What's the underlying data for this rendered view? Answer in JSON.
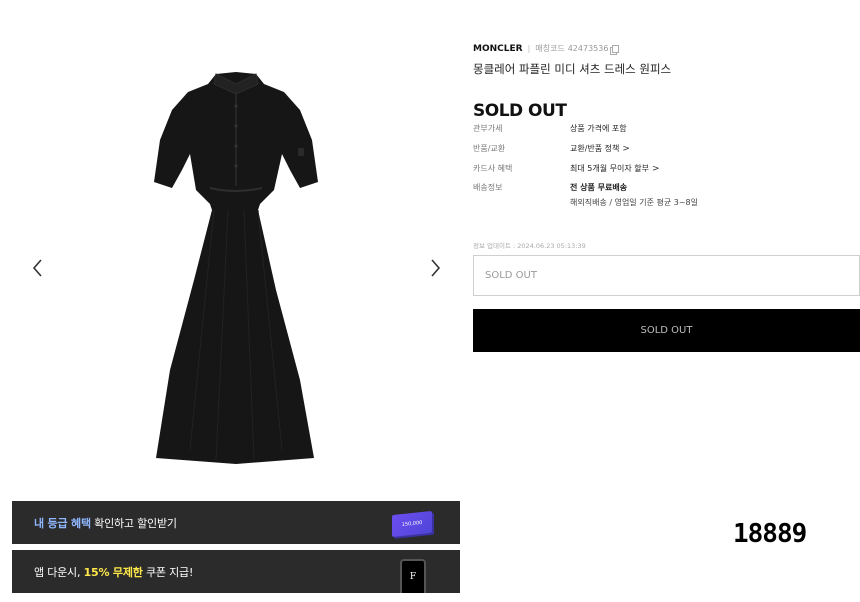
{
  "gallery": {
    "prev_icon": "chevron-left-icon",
    "next_icon": "chevron-right-icon",
    "image_alt": "black midi shirt dress"
  },
  "banners": {
    "grade": {
      "highlight": "내 등급 혜택",
      "text": " 확인하고 할인받기",
      "card_amount": "150,000"
    },
    "app": {
      "prefix": "앱 다운시, ",
      "highlight": "15% 무제한",
      "suffix": " 쿠폰 지급!",
      "phone_letter": "F"
    }
  },
  "watermark": "18889",
  "product": {
    "brand": "MONCLER",
    "code_label": "매칭코드",
    "code_value": "42473536",
    "name": "몽클레어 파플린 미디 셔츠 드레스 원피스",
    "status": "SOLD OUT"
  },
  "specs": [
    {
      "label": "관부가세",
      "value": "상품 가격에 포함"
    },
    {
      "label": "반품/교환",
      "value": "교환/반품 정책",
      "chevron": ">"
    },
    {
      "label": "카드사 혜택",
      "value": "최대 5개월 무이자 할부",
      "chevron": ">"
    },
    {
      "label": "배송정보",
      "value": "전 상품 무료배송",
      "sub": "해외직배송 / 영업일 기준 평균 3~8일"
    }
  ],
  "updated_at": "정보 업데이트 : 2024.06.23 05:13:39",
  "option_select": {
    "value": "SOLD OUT"
  },
  "buy_button": {
    "label": "SOLD OUT"
  },
  "colors": {
    "banner_bg": "#2b2b2b",
    "button_bg": "#000000",
    "accent_blue": "#8fb6ff",
    "accent_yellow": "#ffe84a"
  }
}
